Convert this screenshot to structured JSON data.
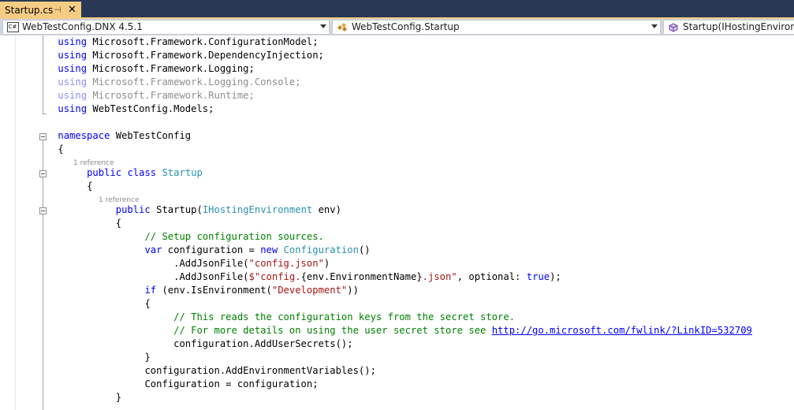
{
  "tab": {
    "title": "Startup.cs",
    "pin_glyph": "⊣",
    "close_glyph": "✕"
  },
  "navbar": {
    "project": "WebTestConfig.DNX 4.5.1",
    "project_icon": "csharp-project-icon",
    "type_scope": "WebTestConfig.Startup",
    "type_icon": "class-icon",
    "member": "Startup(IHostingEnvironme",
    "member_icon": "method-icon"
  },
  "code": {
    "l01": {
      "kw": "using",
      "rest": " Microsoft.Framework.ConfigurationModel;"
    },
    "l02": {
      "kw": "using",
      "rest": " Microsoft.Framework.DependencyInjection;"
    },
    "l03": {
      "kw": "using",
      "rest": " Microsoft.Framework.Logging;"
    },
    "l04": {
      "kw": "using",
      "rest": " Microsoft.Framework.Logging.Console;"
    },
    "l05": {
      "kw": "using",
      "rest": " Microsoft.Framework.Runtime;"
    },
    "l06": {
      "kw": "using",
      "rest": " WebTestConfig.Models;"
    },
    "l08": {
      "kw": "namespace",
      "rest": " WebTestConfig"
    },
    "l09": {
      "text": "{"
    },
    "lens1": "1 reference",
    "l10": {
      "kw1": "public",
      "kw2": "class",
      "type": "Startup"
    },
    "l11": {
      "text": "{"
    },
    "lens2": "1 reference",
    "l12": {
      "kw": "public",
      "name": " Startup(",
      "type": "IHostingEnvironment",
      "rest": " env)"
    },
    "l13": {
      "text": "{"
    },
    "l14": {
      "comment": "// Setup configuration sources."
    },
    "l15": {
      "kw1": "var",
      "mid": " configuration = ",
      "kw2": "new",
      "type": "Configuration",
      "end": "()"
    },
    "l16": {
      "pre": ".AddJsonFile(",
      "str": "\"config.json\"",
      "post": ")"
    },
    "l17": {
      "pre": ".AddJsonFile(",
      "str1": "$\"config.",
      "interp": "{env.EnvironmentName}",
      "str2": ".json\"",
      "mid": ", optional: ",
      "kw": "true",
      "post": ");"
    },
    "l18": {
      "kw": "if",
      "pre": " (env.IsEnvironment(",
      "str": "\"Development\"",
      "post": "))"
    },
    "l19": {
      "text": "{"
    },
    "l20": {
      "comment": "// This reads the configuration keys from the secret store."
    },
    "l21": {
      "comment": "// For more details on using the user secret store see ",
      "link": "http://go.microsoft.com/fwlink/?LinkID=532709"
    },
    "l22": {
      "text": "configuration.AddUserSecrets();"
    },
    "l23": {
      "text": "}"
    },
    "l24": {
      "text": "configuration.AddEnvironmentVariables();"
    },
    "l25": {
      "text": "Configuration = configuration;"
    },
    "l26": {
      "text": "}"
    }
  },
  "colors": {
    "keyword": "#0000ff",
    "type": "#2b91af",
    "string": "#a31515",
    "comment": "#008000",
    "tab_active": "#f5cc84",
    "tabstrip": "#293955"
  }
}
